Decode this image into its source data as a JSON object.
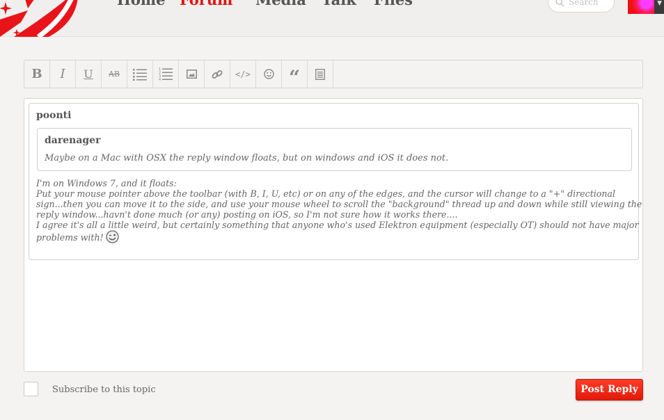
{
  "nav": {
    "items": [
      {
        "label": "Home",
        "active": false
      },
      {
        "label": "Forum",
        "active": true
      },
      {
        "label": "Media",
        "active": false
      },
      {
        "label": "Talk",
        "active": false
      },
      {
        "label": "Files",
        "active": false
      }
    ],
    "search_placeholder": "Search",
    "accent_color": "#e01414"
  },
  "toolbar": {
    "buttons": [
      {
        "label": "B",
        "icon": "bold-icon"
      },
      {
        "label": "I",
        "icon": "italic-icon"
      },
      {
        "label": "U",
        "icon": "underline-icon"
      },
      {
        "label": "AB",
        "icon": "strikethrough-icon"
      },
      {
        "label": "",
        "icon": "bulleted-list-icon"
      },
      {
        "label": "",
        "icon": "numbered-list-icon"
      },
      {
        "label": "",
        "icon": "image-icon"
      },
      {
        "label": "",
        "icon": "link-icon"
      },
      {
        "label": "</>",
        "icon": "code-icon"
      },
      {
        "label": "",
        "icon": "smiley-icon"
      },
      {
        "label": "“",
        "icon": "quote-icon"
      },
      {
        "label": "",
        "icon": "document-icon"
      }
    ]
  },
  "editor": {
    "outer_quote_author": "poonti",
    "inner_quote": {
      "author": "darenager",
      "text": "Maybe on a Mac with OSX the reply window floats, but on windows and iOS it does not."
    },
    "reply_lines": [
      "I'm on Windows 7, and it floats:",
      "Put your mouse pointer above the toolbar (with B, I, U, etc) or on any of the edges, and the cursor will change to a \"+\" directional",
      "sign...then you can move it to the side, and use your mouse wheel to scroll the \"background\" thread up and down while still viewing the",
      "reply window...havn't done much (or any) posting on iOS, so I'm not sure how it works there....",
      "I agree it's all a little weird, but certainly something that anyone who's used Elektron equipment (especially OT) should not have major",
      "problems with!"
    ]
  },
  "footer": {
    "subscribe_label": "Subscribe to this topic",
    "post_button": "Post Reply"
  }
}
